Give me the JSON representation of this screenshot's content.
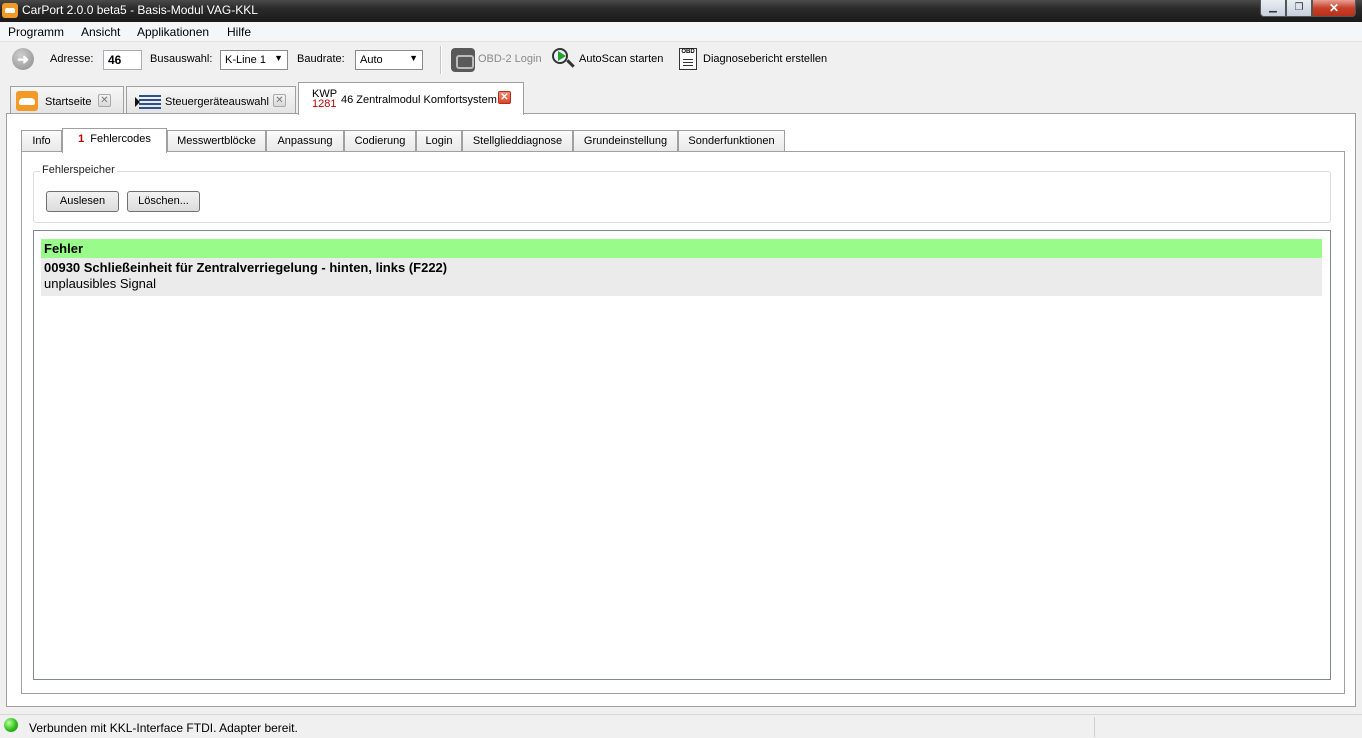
{
  "window": {
    "title": "CarPort 2.0.0 beta5 - Basis-Modul VAG-KKL",
    "minimize": "▁",
    "maximize": "❐",
    "close": "✕"
  },
  "menu": [
    "Programm",
    "Ansicht",
    "Applikationen",
    "Hilfe"
  ],
  "toolbar": {
    "address_label": "Adresse:",
    "address_value": "46",
    "bus_label": "Busauswahl:",
    "bus_value": "K-Line 1",
    "baud_label": "Baudrate:",
    "baud_value": "Auto",
    "obd_login": "OBD-2 Login",
    "autoscan": "AutoScan starten",
    "report": "Diagnosebericht erstellen",
    "report_icon_text": "OBD"
  },
  "module_tabs": [
    {
      "label": "Startseite",
      "close": "✕"
    },
    {
      "label": "Steuergeräteauswahl",
      "close": "✕"
    },
    {
      "protocol": "KWP",
      "protocol_num": "1281",
      "label": "46 Zentralmodul Komfortsystem",
      "close": "✕"
    }
  ],
  "sub_tabs": [
    "Info",
    "Fehlercodes",
    "Messwertblöcke",
    "Anpassung",
    "Codierung",
    "Login",
    "Stellglieddiagnose",
    "Grundeinstellung",
    "Sonderfunktionen"
  ],
  "fault_count": "1",
  "fault_memory": {
    "title": "Fehlerspeicher",
    "read_button": "Auslesen",
    "clear_button": "Löschen..."
  },
  "results": {
    "header": "Fehler",
    "rows": [
      {
        "code": "00930 Schließeinheit für Zentralverriegelung - hinten, links (F222)",
        "detail": "unplausibles Signal"
      }
    ]
  },
  "status": {
    "text": "Verbunden mit KKL-Interface FTDI. Adapter bereit."
  },
  "colors": {
    "result_header": "#98fb8a",
    "fault_count": "#c00000",
    "status_led": "#2fbf1a"
  }
}
